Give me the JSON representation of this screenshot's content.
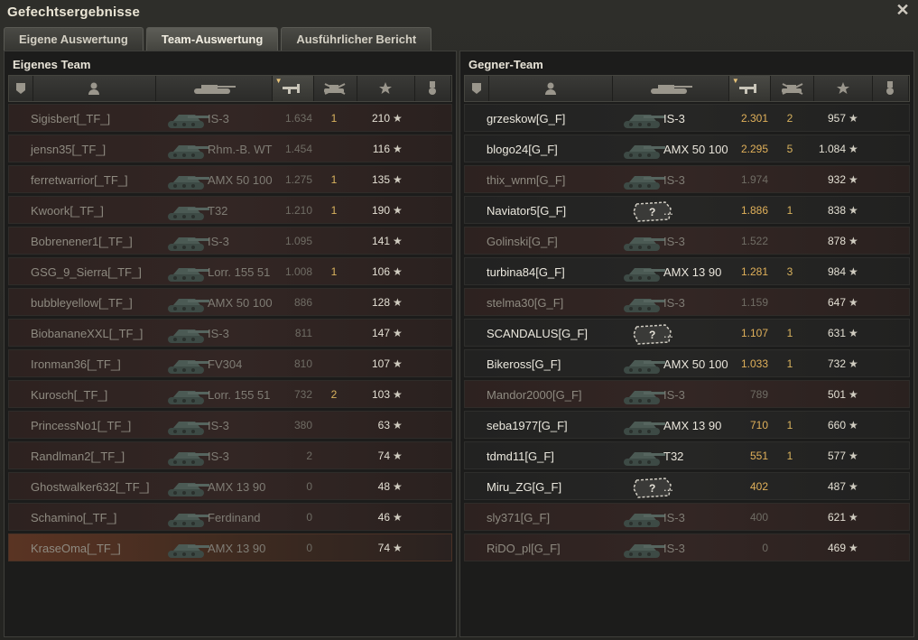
{
  "window": {
    "title": "Gefechtsergebnisse",
    "close_glyph": "✕"
  },
  "tabs": [
    {
      "label": "Eigene Auswertung",
      "active": false
    },
    {
      "label": "Team-Auswertung",
      "active": true
    },
    {
      "label": "Ausführlicher Bericht",
      "active": false
    }
  ],
  "headers": {
    "icons": [
      "squad-icon",
      "player-icon",
      "tank-icon",
      "damage-icon",
      "frags-icon",
      "xp-star-icon",
      "medal-icon"
    ],
    "sorted_column": "damage-icon",
    "sort_glyph": "▼"
  },
  "star_glyph": "★",
  "unknown_tank_glyph": "?",
  "teams": {
    "own": {
      "title": "Eigenes Team",
      "rows": [
        {
          "name": "Sigisbert[_TF_]",
          "tank": "IS-3",
          "damage": "1.634",
          "kills": "1",
          "xp": "210",
          "state": "dead"
        },
        {
          "name": "jensn35[_TF_]",
          "tank": "Rhm.-B. WT",
          "damage": "1.454",
          "kills": "",
          "xp": "116",
          "state": "dead"
        },
        {
          "name": "ferretwarrior[_TF_]",
          "tank": "AMX 50 100",
          "damage": "1.275",
          "kills": "1",
          "xp": "135",
          "state": "dead"
        },
        {
          "name": "Kwoork[_TF_]",
          "tank": "T32",
          "damage": "1.210",
          "kills": "1",
          "xp": "190",
          "state": "dead"
        },
        {
          "name": "Bobrenener1[_TF_]",
          "tank": "IS-3",
          "damage": "1.095",
          "kills": "",
          "xp": "141",
          "state": "dead"
        },
        {
          "name": "GSG_9_Sierra[_TF_]",
          "tank": "Lorr. 155 51",
          "damage": "1.008",
          "kills": "1",
          "xp": "106",
          "state": "dead"
        },
        {
          "name": "bubbleyellow[_TF_]",
          "tank": "AMX 50 100",
          "damage": "886",
          "kills": "",
          "xp": "128",
          "state": "dead"
        },
        {
          "name": "BiobananeXXL[_TF_]",
          "tank": "IS-3",
          "damage": "811",
          "kills": "",
          "xp": "147",
          "state": "dead"
        },
        {
          "name": "Ironman36[_TF_]",
          "tank": "FV304",
          "damage": "810",
          "kills": "",
          "xp": "107",
          "state": "dead"
        },
        {
          "name": "Kurosch[_TF_]",
          "tank": "Lorr. 155 51",
          "damage": "732",
          "kills": "2",
          "xp": "103",
          "state": "dead"
        },
        {
          "name": "PrincessNo1[_TF_]",
          "tank": "IS-3",
          "damage": "380",
          "kills": "",
          "xp": "63",
          "state": "dead"
        },
        {
          "name": "Randlman2[_TF_]",
          "tank": "IS-3",
          "damage": "2",
          "kills": "",
          "xp": "74",
          "state": "dead"
        },
        {
          "name": "Ghostwalker632[_TF_]",
          "tank": "AMX 13 90",
          "damage": "0",
          "kills": "",
          "xp": "48",
          "state": "dead"
        },
        {
          "name": "Schamino[_TF_]",
          "tank": "Ferdinand",
          "damage": "0",
          "kills": "",
          "xp": "46",
          "state": "dead"
        },
        {
          "name": "KraseOma[_TF_]",
          "tank": "AMX 13 90",
          "damage": "0",
          "kills": "",
          "xp": "74",
          "state": "self"
        }
      ]
    },
    "enemy": {
      "title": "Gegner-Team",
      "rows": [
        {
          "name": "grzeskow[G_F]",
          "tank": "IS-3",
          "damage": "2.301",
          "kills": "2",
          "xp": "957",
          "state": "alive"
        },
        {
          "name": "blogo24[G_F]",
          "tank": "AMX 50 100",
          "damage": "2.295",
          "kills": "5",
          "xp": "1.084",
          "state": "alive"
        },
        {
          "name": "thix_wnm[G_F]",
          "tank": "IS-3",
          "damage": "1.974",
          "kills": "",
          "xp": "932",
          "state": "dead"
        },
        {
          "name": "Naviator5[G_F]",
          "tank": "...",
          "damage": "1.886",
          "kills": "1",
          "xp": "838",
          "state": "alive",
          "unknown": true
        },
        {
          "name": "Golinski[G_F]",
          "tank": "IS-3",
          "damage": "1.522",
          "kills": "",
          "xp": "878",
          "state": "dead"
        },
        {
          "name": "turbina84[G_F]",
          "tank": "AMX 13 90",
          "damage": "1.281",
          "kills": "3",
          "xp": "984",
          "state": "alive"
        },
        {
          "name": "stelma30[G_F]",
          "tank": "IS-3",
          "damage": "1.159",
          "kills": "",
          "xp": "647",
          "state": "dead"
        },
        {
          "name": "SCANDALUS[G_F]",
          "tank": "...",
          "damage": "1.107",
          "kills": "1",
          "xp": "631",
          "state": "alive",
          "unknown": true
        },
        {
          "name": "Bikeross[G_F]",
          "tank": "AMX 50 100",
          "damage": "1.033",
          "kills": "1",
          "xp": "732",
          "state": "alive"
        },
        {
          "name": "Mandor2000[G_F]",
          "tank": "IS-3",
          "damage": "789",
          "kills": "",
          "xp": "501",
          "state": "dead"
        },
        {
          "name": "seba1977[G_F]",
          "tank": "AMX 13 90",
          "damage": "710",
          "kills": "1",
          "xp": "660",
          "state": "alive"
        },
        {
          "name": "tdmd11[G_F]",
          "tank": "T32",
          "damage": "551",
          "kills": "1",
          "xp": "577",
          "state": "alive"
        },
        {
          "name": "Miru_ZG[G_F]",
          "tank": "...",
          "damage": "402",
          "kills": "",
          "xp": "487",
          "state": "alive",
          "unknown": true
        },
        {
          "name": "sly371[G_F]",
          "tank": "IS-3",
          "damage": "400",
          "kills": "",
          "xp": "621",
          "state": "dead"
        },
        {
          "name": "RiDO_pl[G_F]",
          "tank": "IS-3",
          "damage": "0",
          "kills": "",
          "xp": "469",
          "state": "dead"
        }
      ]
    }
  }
}
